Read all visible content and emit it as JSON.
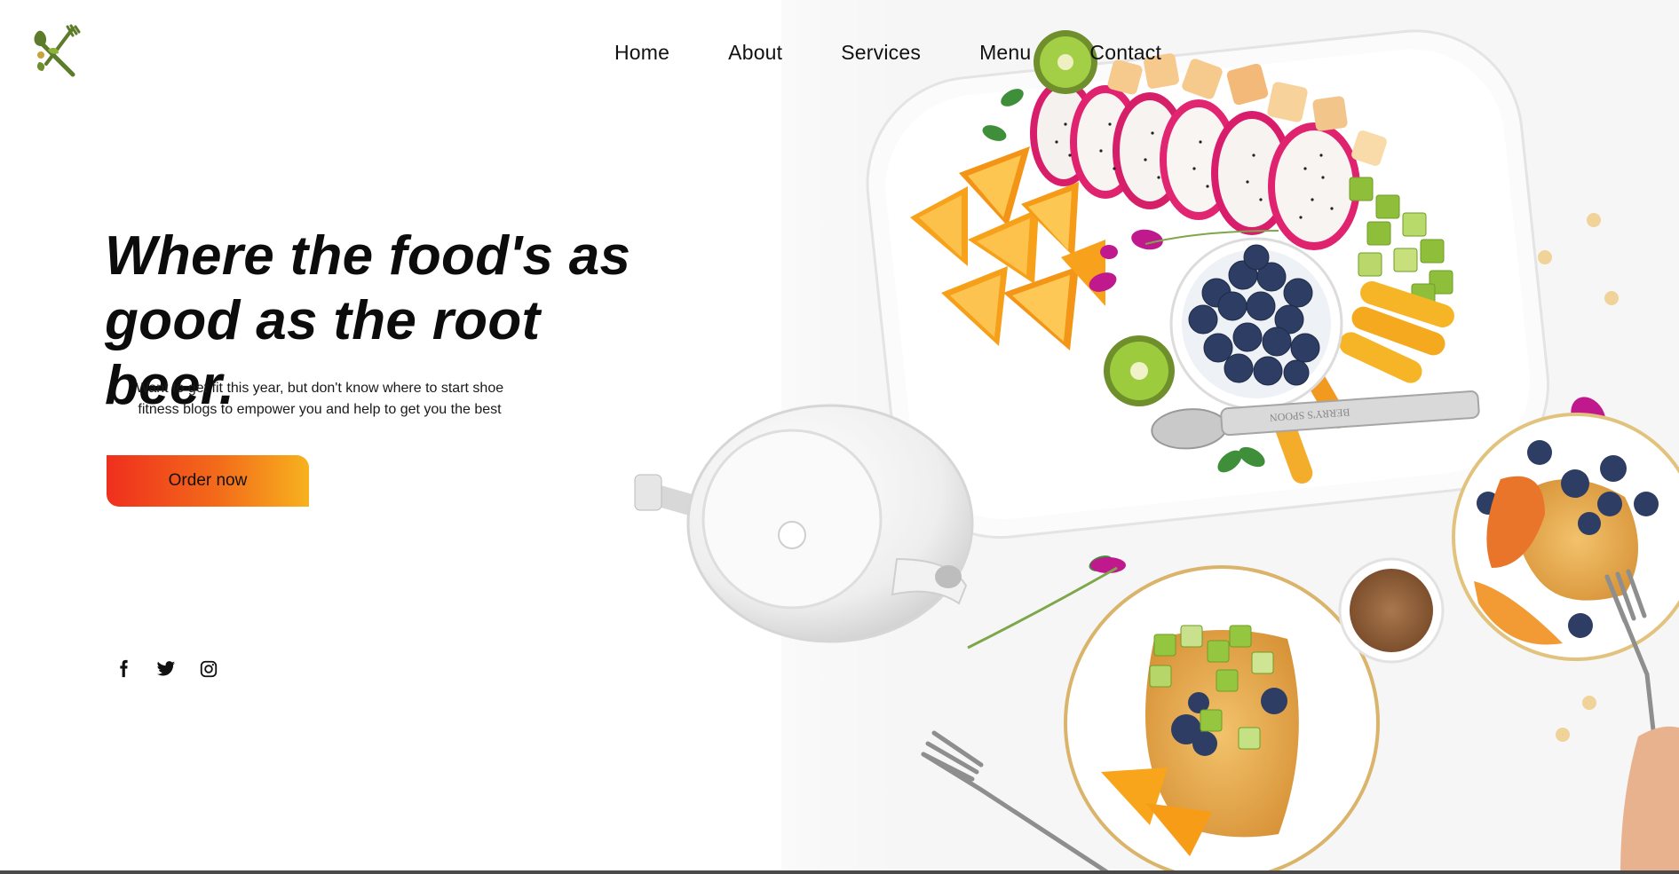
{
  "brand": {
    "logo_icon": "spoon-fork-leaf-icon"
  },
  "nav": {
    "items": [
      {
        "label": "Home"
      },
      {
        "label": "About"
      },
      {
        "label": "Services"
      },
      {
        "label": "Menu"
      },
      {
        "label": "Contact"
      }
    ]
  },
  "hero": {
    "headline_line1": "Where the food's as",
    "headline_line2": "good as the root beer.",
    "subtext_line1": "Want to get fit this year, but don't know where to start shoe",
    "subtext_line2": "fitness blogs to empower you and help to get you the best",
    "cta_label": "Order now",
    "cta_gradient": [
      "#ef2f1d",
      "#f7b21e"
    ],
    "image_icon": "breakfast-food-photo"
  },
  "social": {
    "icons": [
      "facebook-icon",
      "twitter-icon",
      "instagram-icon"
    ]
  }
}
